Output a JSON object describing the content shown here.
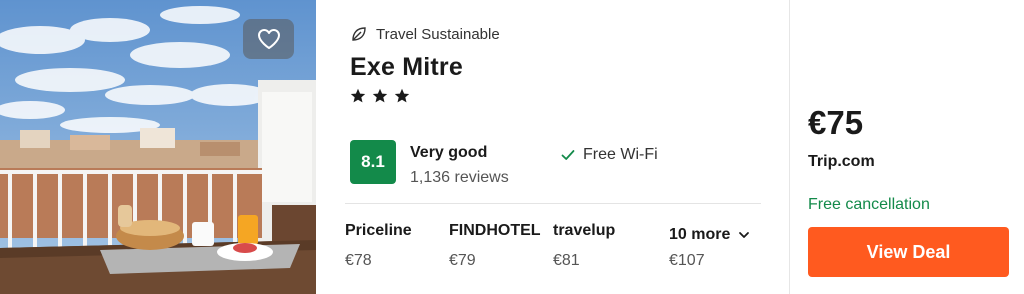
{
  "hotel": {
    "sustainable_label": "Travel Sustainable",
    "name": "Exe Mitre",
    "star_count": 3,
    "rating_score": "8.1",
    "rating_label": "Very good",
    "reviews": "1,136 reviews",
    "amenity": "Free Wi-Fi",
    "favorite_icon": "heart-icon",
    "sustainable_icon": "leaf-icon"
  },
  "providers": [
    {
      "name": "Priceline",
      "price": "€78"
    },
    {
      "name": "FINDHOTEL",
      "price": "€79"
    },
    {
      "name": "travelup",
      "price": "€81"
    }
  ],
  "more": {
    "label": "10 more",
    "price": "€107"
  },
  "deal": {
    "price": "€75",
    "provider": "Trip.com",
    "cancellation": "Free cancellation",
    "button_label": "View Deal"
  },
  "colors": {
    "rating_green": "#138a4a",
    "cta_orange": "#ff5a1f",
    "cancel_green": "#138a4a"
  }
}
